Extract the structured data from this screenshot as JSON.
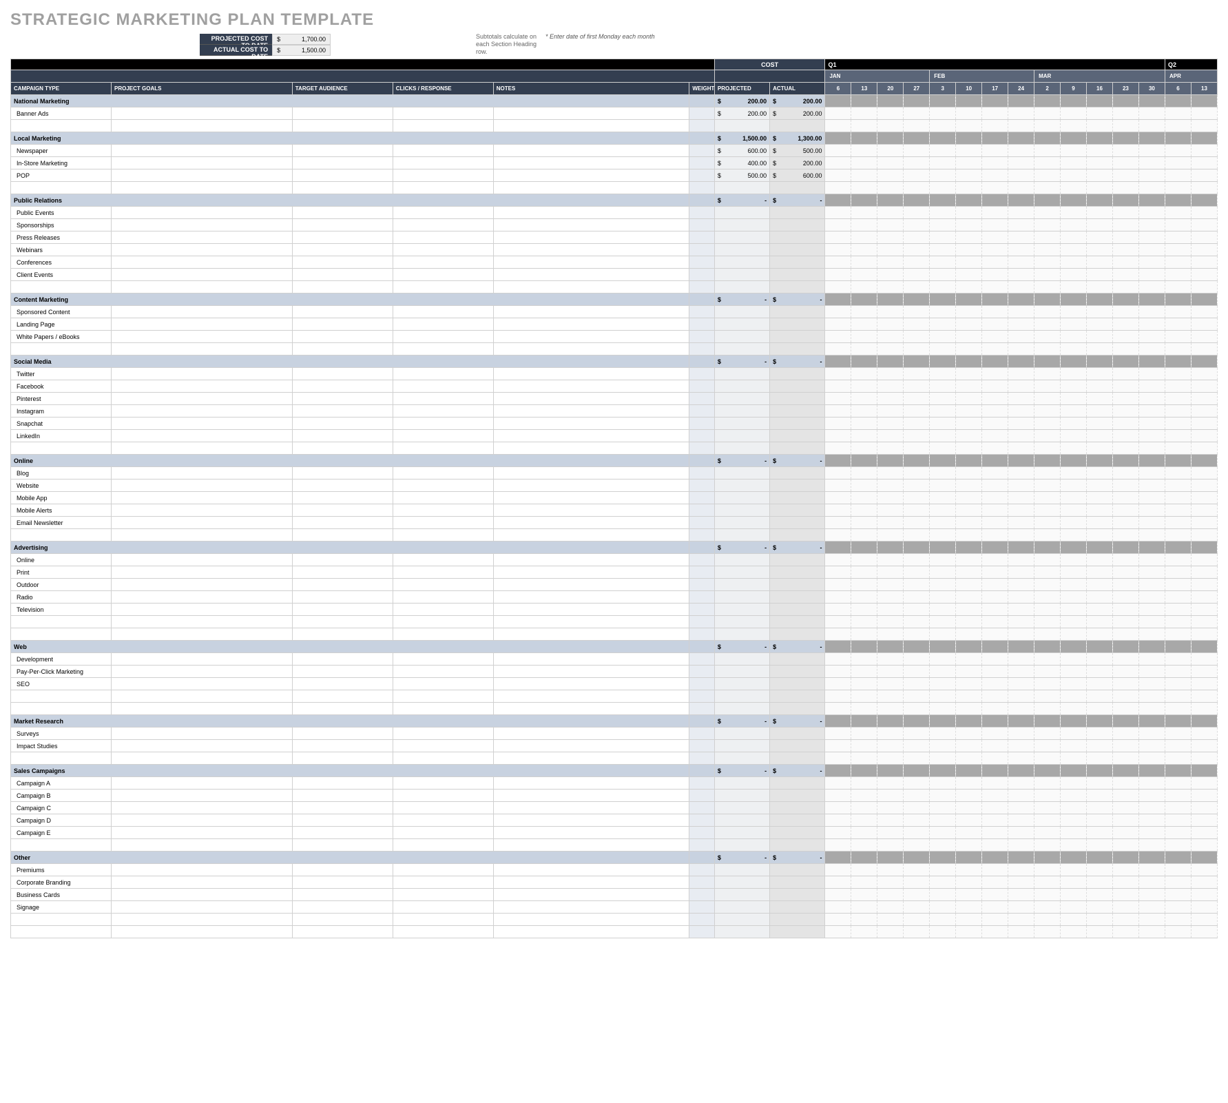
{
  "title": "STRATEGIC MARKETING PLAN TEMPLATE",
  "costs": {
    "projLbl": "PROJECTED COST TO DATE",
    "projVal": "1,700.00",
    "actLbl": "ACTUAL COST TO DATE",
    "actVal": "1,500.00",
    "sym": "$"
  },
  "notes": {
    "subtotal": "Subtotals calculate on each Section Heading row.",
    "monday": "* Enter date of first Monday each month"
  },
  "cols": [
    "CAMPAIGN TYPE",
    "PROJECT GOALS",
    "TARGET AUDIENCE",
    "CLICKS / RESPONSE",
    "NOTES",
    "WEIGHT"
  ],
  "costHdr": "COST",
  "costCols": [
    "PROJECTED",
    "ACTUAL"
  ],
  "quarters": [
    "Q1",
    "Q2"
  ],
  "months": [
    "JAN",
    "FEB",
    "MAR",
    "APR"
  ],
  "days": [
    "6",
    "13",
    "20",
    "27",
    "3",
    "10",
    "17",
    "24",
    "2",
    "9",
    "16",
    "23",
    "30",
    "6",
    "13"
  ],
  "sections": [
    {
      "name": "National Marketing",
      "proj": "200.00",
      "act": "200.00",
      "items": [
        {
          "n": "Banner Ads",
          "p": "200.00",
          "a": "200.00"
        },
        {
          "n": ""
        }
      ]
    },
    {
      "name": "Local Marketing",
      "proj": "1,500.00",
      "act": "1,300.00",
      "items": [
        {
          "n": "Newspaper",
          "p": "600.00",
          "a": "500.00"
        },
        {
          "n": "In-Store Marketing",
          "p": "400.00",
          "a": "200.00"
        },
        {
          "n": "POP",
          "p": "500.00",
          "a": "600.00"
        },
        {
          "n": ""
        }
      ]
    },
    {
      "name": "Public Relations",
      "proj": "-",
      "act": "-",
      "items": [
        {
          "n": "Public Events"
        },
        {
          "n": "Sponsorships"
        },
        {
          "n": "Press Releases"
        },
        {
          "n": "Webinars"
        },
        {
          "n": "Conferences"
        },
        {
          "n": "Client Events"
        },
        {
          "n": ""
        }
      ]
    },
    {
      "name": "Content Marketing",
      "proj": "-",
      "act": "-",
      "items": [
        {
          "n": "Sponsored Content"
        },
        {
          "n": "Landing Page"
        },
        {
          "n": "White Papers / eBooks"
        },
        {
          "n": ""
        }
      ]
    },
    {
      "name": "Social Media",
      "proj": "-",
      "act": "-",
      "items": [
        {
          "n": "Twitter"
        },
        {
          "n": "Facebook"
        },
        {
          "n": "Pinterest"
        },
        {
          "n": "Instagram"
        },
        {
          "n": "Snapchat"
        },
        {
          "n": "LinkedIn"
        },
        {
          "n": ""
        }
      ]
    },
    {
      "name": "Online",
      "proj": "-",
      "act": "-",
      "items": [
        {
          "n": "Blog"
        },
        {
          "n": "Website"
        },
        {
          "n": "Mobile App"
        },
        {
          "n": "Mobile Alerts"
        },
        {
          "n": "Email Newsletter"
        },
        {
          "n": ""
        }
      ]
    },
    {
      "name": "Advertising",
      "proj": "-",
      "act": "-",
      "items": [
        {
          "n": "Online"
        },
        {
          "n": "Print"
        },
        {
          "n": "Outdoor"
        },
        {
          "n": "Radio"
        },
        {
          "n": "Television"
        },
        {
          "n": ""
        },
        {
          "n": ""
        }
      ]
    },
    {
      "name": "Web",
      "proj": "-",
      "act": "-",
      "items": [
        {
          "n": "Development"
        },
        {
          "n": "Pay-Per-Click Marketing"
        },
        {
          "n": "SEO"
        },
        {
          "n": ""
        },
        {
          "n": ""
        }
      ]
    },
    {
      "name": "Market Research",
      "proj": "-",
      "act": "-",
      "items": [
        {
          "n": "Surveys"
        },
        {
          "n": "Impact Studies"
        },
        {
          "n": ""
        }
      ]
    },
    {
      "name": "Sales Campaigns",
      "proj": "-",
      "act": "-",
      "items": [
        {
          "n": "Campaign A"
        },
        {
          "n": "Campaign B"
        },
        {
          "n": "Campaign C"
        },
        {
          "n": "Campaign D"
        },
        {
          "n": "Campaign E"
        },
        {
          "n": ""
        }
      ]
    },
    {
      "name": "Other",
      "proj": "-",
      "act": "-",
      "items": [
        {
          "n": "Premiums"
        },
        {
          "n": "Corporate Branding"
        },
        {
          "n": "Business Cards"
        },
        {
          "n": "Signage"
        },
        {
          "n": ""
        },
        {
          "n": ""
        }
      ]
    }
  ]
}
